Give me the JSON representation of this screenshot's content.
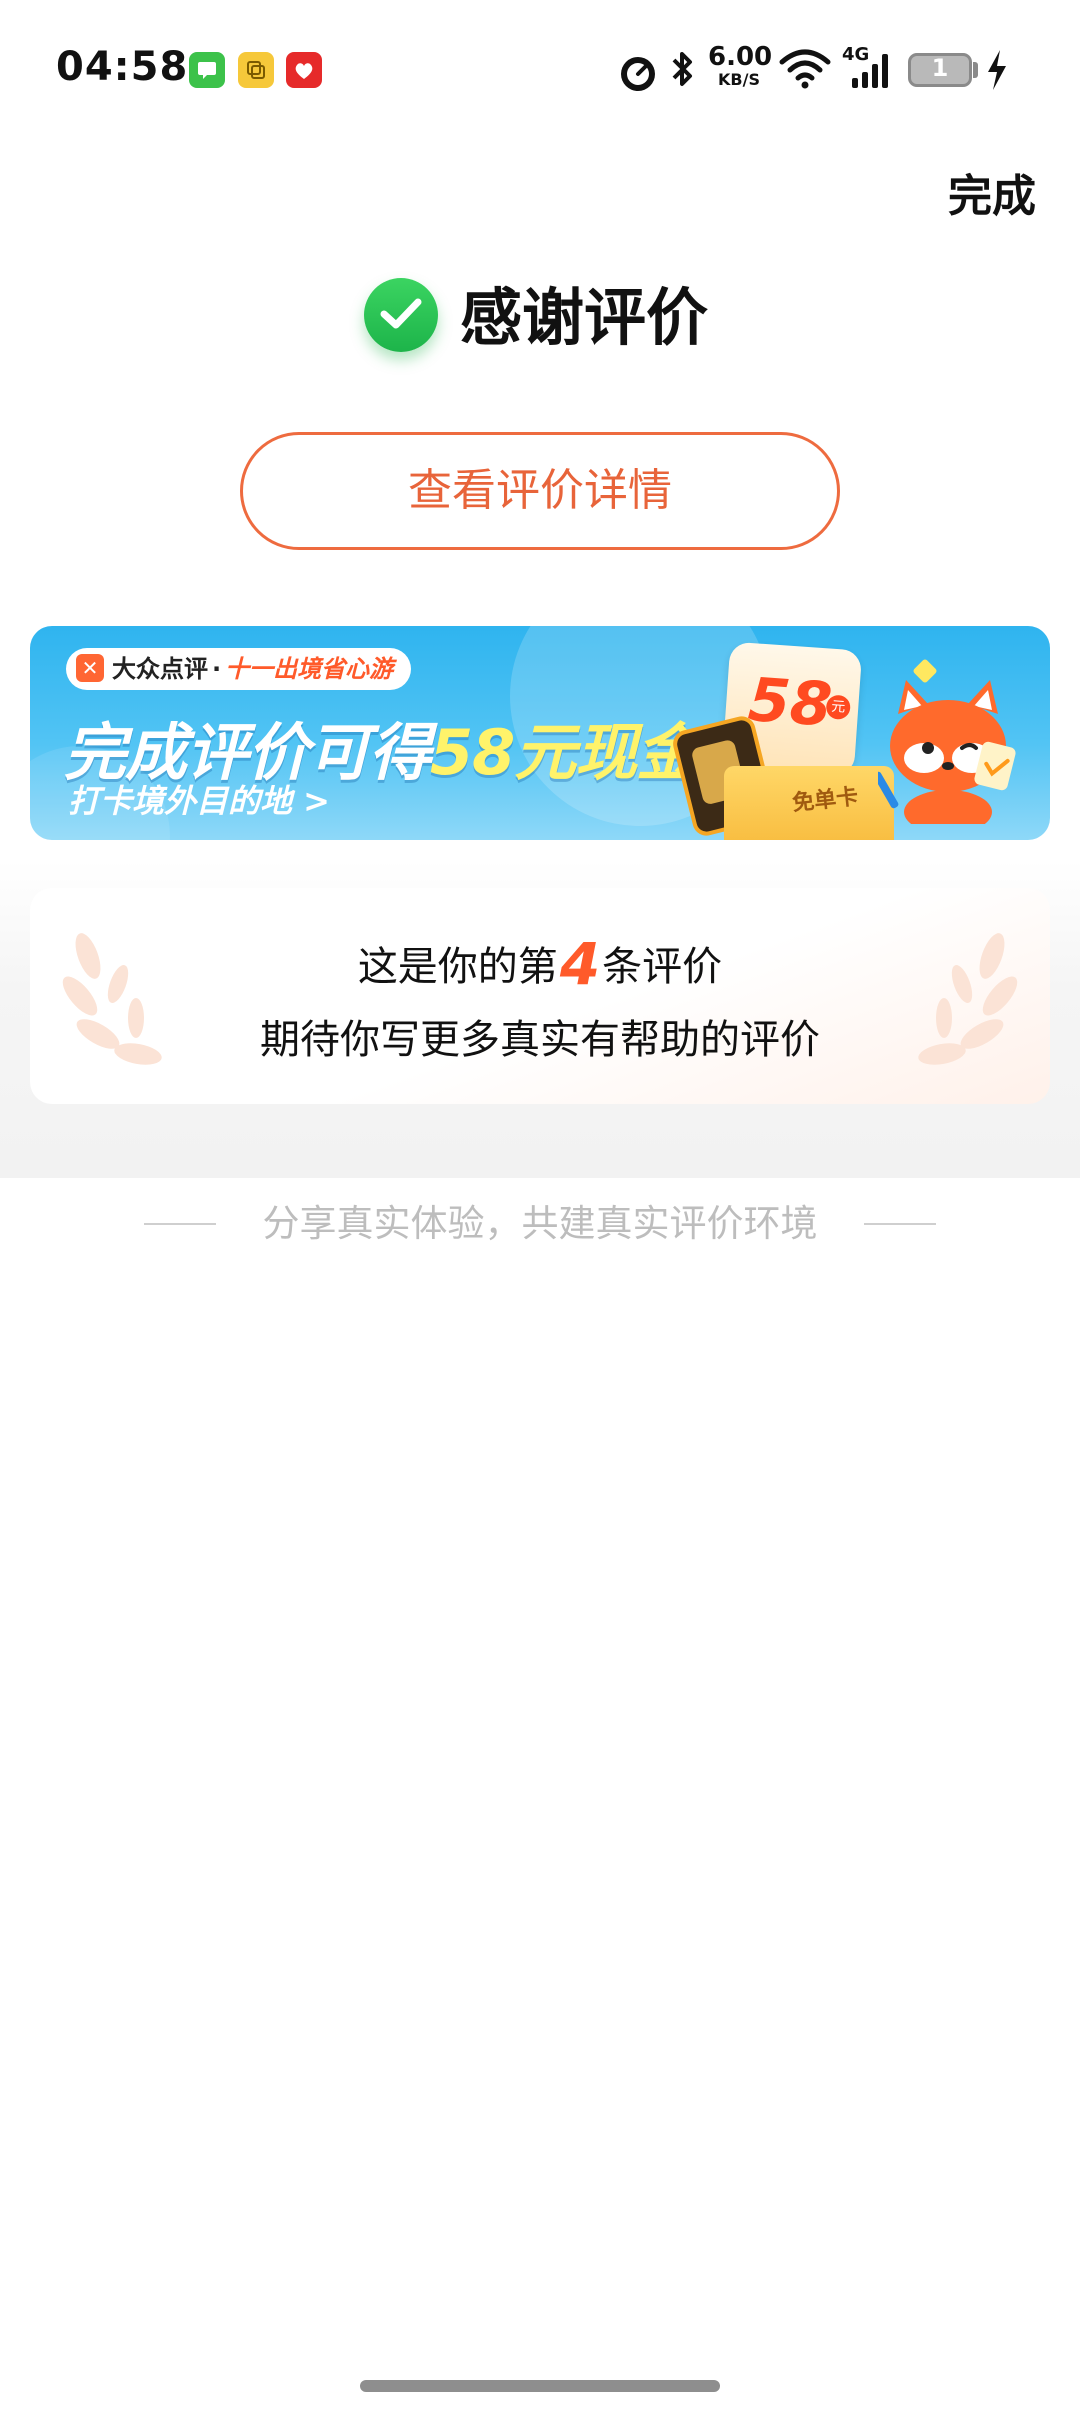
{
  "status_bar": {
    "time": "04:58",
    "net_speed_value": "6.00",
    "net_speed_unit": "KB/S",
    "network_type": "4G",
    "battery_level": "1",
    "notification_icons": [
      "messages-icon",
      "copy-app-icon",
      "pinduoduo-icon"
    ]
  },
  "header": {
    "done_label": "完成"
  },
  "result": {
    "title": "感谢评价",
    "detail_button_label": "查看评价详情"
  },
  "banner": {
    "brand": "大众点评",
    "brand_tag": "十一出境省心游",
    "headline_prefix": "完成评价可得",
    "headline_highlight": "58元现金",
    "subline": "打卡境外目的地 >",
    "card_amount": "58",
    "card_unit": "元",
    "box_label": "免单卡"
  },
  "review_count": {
    "line1_prefix": "这是你的第",
    "count": "4",
    "line1_suffix": "条评价",
    "line2": "期待你写更多真实有帮助的评价"
  },
  "slogan": "分享真实体验，共建真实评价环境",
  "colors": {
    "accent_orange": "#ee6b3f",
    "success_green": "#1db44a",
    "banner_blue": "#2fb4ef",
    "highlight_yellow": "#fff36a"
  }
}
